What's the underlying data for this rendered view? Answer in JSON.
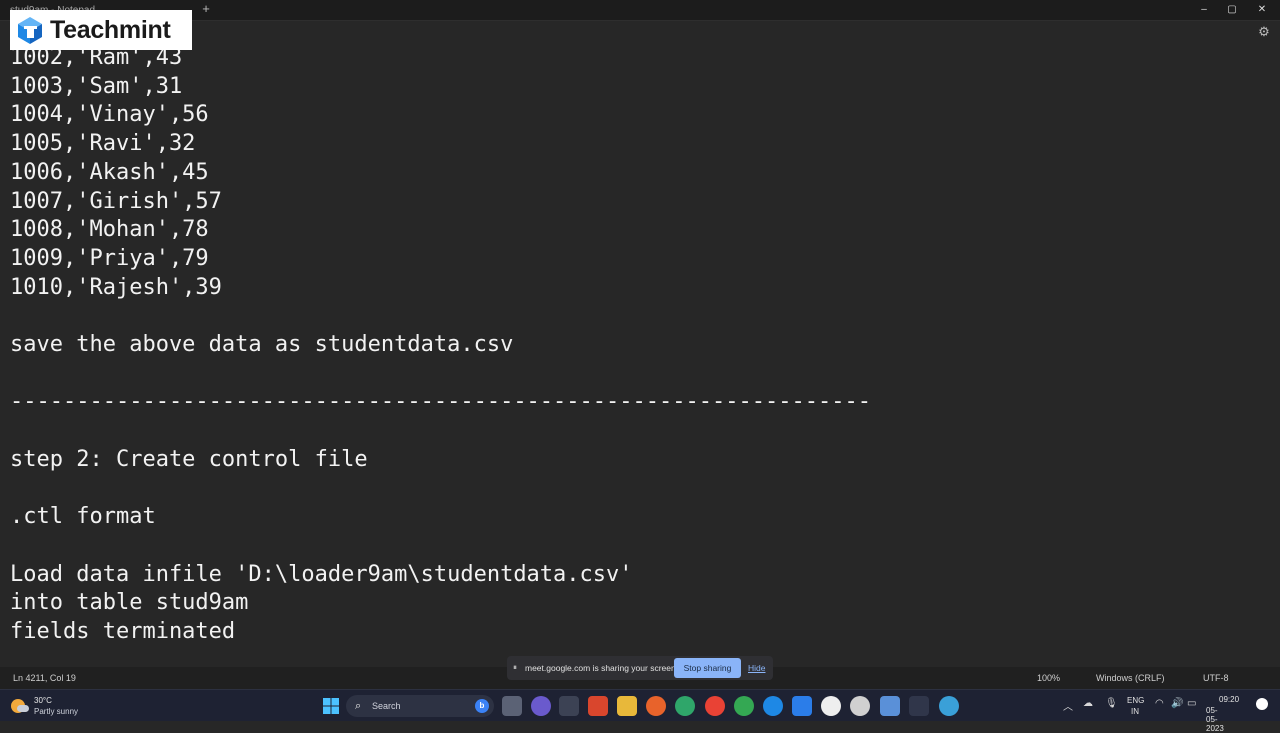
{
  "titlebar": {
    "tab_title": "stud9am - Notepad",
    "new_tab": "+",
    "minimize": "–",
    "maximize": "▢",
    "close": "✕"
  },
  "menubar": {
    "settings_icon": "gear-icon"
  },
  "logo": {
    "text": "Teachmint",
    "icon": "teachmint-cube-icon",
    "color": "#1e88e5"
  },
  "editor": {
    "lines": [
      "1002,'Ram',43",
      "1003,'Sam',31",
      "1004,'Vinay',56",
      "1005,'Ravi',32",
      "1006,'Akash',45",
      "1007,'Girish',57",
      "1008,'Mohan',78",
      "1009,'Priya',79",
      "1010,'Rajesh',39",
      "",
      "save the above data as studentdata.csv",
      "",
      "-----------------------------------------------------------------",
      "",
      "step 2: Create control file",
      "",
      ".ctl format",
      "",
      "Load data infile 'D:\\loader9am\\studentdata.csv'",
      "into table stud9am",
      "fields terminated"
    ]
  },
  "statusbar": {
    "position": "Ln 4211, Col 19",
    "zoom": "100%",
    "line_endings": "Windows (CRLF)",
    "encoding": "UTF-8"
  },
  "sharebar": {
    "pause_icon": "⏸",
    "message": "meet.google.com is sharing your screen.",
    "stop_label": "Stop sharing",
    "hide_label": "Hide"
  },
  "taskbar": {
    "weather_temp": "30°C",
    "weather_condition": "Partly sunny",
    "search_label": "Search",
    "tray_language": "ENG",
    "tray_region": "IN",
    "time": "09:20",
    "date": "05-05-2023"
  }
}
